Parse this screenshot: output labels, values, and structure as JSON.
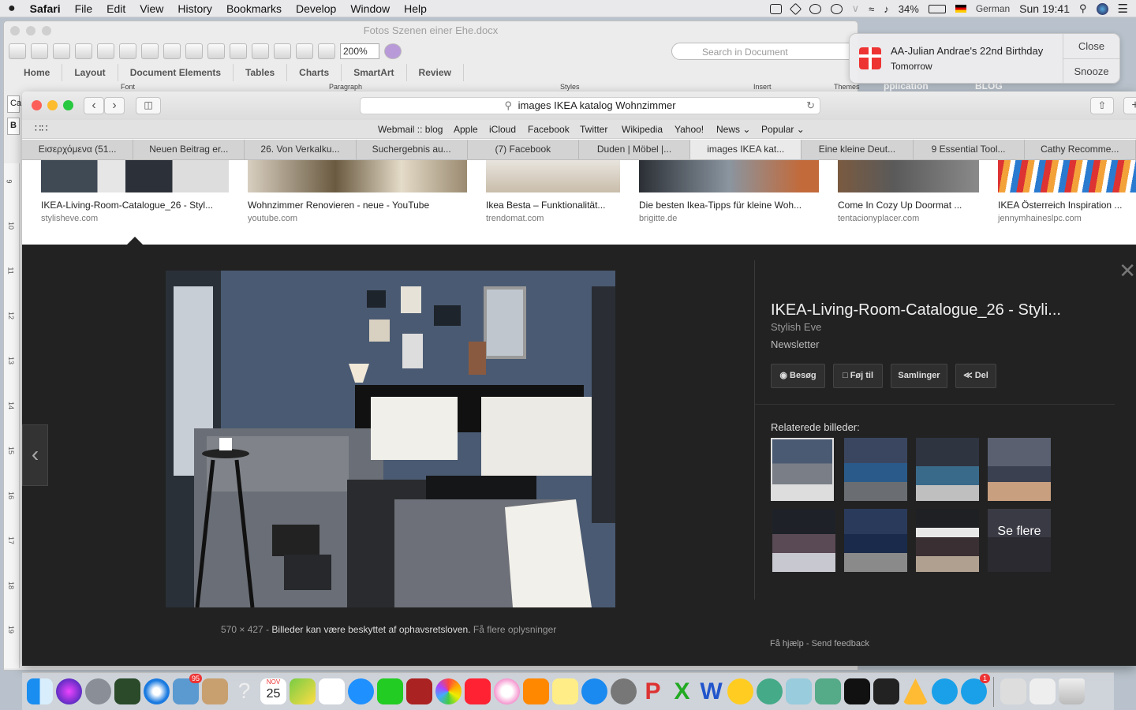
{
  "menubar": {
    "app": "Safari",
    "items": [
      "File",
      "Edit",
      "View",
      "History",
      "Bookmarks",
      "Develop",
      "Window",
      "Help"
    ],
    "battery": "34%",
    "input_language": "German",
    "clock": "Sun 19:41"
  },
  "word": {
    "doc_title": "Fotos Szenen einer Ehe.docx",
    "zoom": "200%",
    "search_placeholder": "Search in Document",
    "ribbon_tabs": [
      "Home",
      "Layout",
      "Document Elements",
      "Tables",
      "Charts",
      "SmartArt",
      "Review"
    ],
    "ribbon_groups": [
      "Font",
      "Paragraph",
      "Styles",
      "Insert",
      "Themes"
    ],
    "font_box": "Ca",
    "bold_box": "B",
    "ruler_numbers": [
      "9",
      "10",
      "11",
      "12",
      "13",
      "14",
      "15",
      "16",
      "17",
      "18",
      "19"
    ]
  },
  "background_text": {
    "application": "pplication",
    "blog": "BLOG"
  },
  "notification": {
    "title": "AA-Julian Andrae's 22nd Birthday",
    "subtitle": "Tomorrow",
    "close": "Close",
    "snooze": "Snooze"
  },
  "safari": {
    "address": "images IKEA katalog Wohnzimmer",
    "favorites": [
      "Webmail :: blog",
      "Apple",
      "iCloud",
      "Facebook",
      "Twitter",
      "Wikipedia",
      "Yahoo!",
      "News",
      "Popular"
    ],
    "tabs": [
      "Εισερχόμενα (51...",
      "Neuen Beitrag er...",
      "26. Von Verkalku...",
      "Suchergebnis au...",
      "(7) Facebook",
      "Duden | Möbel |...",
      "images IKEA kat...",
      "Eine kleine Deut...",
      "9 Essential Tool...",
      "Cathy Recomme..."
    ],
    "active_tab": 6
  },
  "results": [
    {
      "title": "IKEA-Living-Room-Catalogue_26 - Styl...",
      "domain": "stylisheve.com"
    },
    {
      "title": "Wohnzimmer Renovieren - neue - YouTube",
      "domain": "youtube.com"
    },
    {
      "title": "Ikea Besta – Funktionalität...",
      "domain": "trendomat.com"
    },
    {
      "title": "Die besten Ikea-Tipps für kleine Woh...",
      "domain": "brigitte.de"
    },
    {
      "title": "Come In Cozy Up Doormat ...",
      "domain": "tentacionyplacer.com"
    },
    {
      "title": "IKEA Österreich Inspiration ...",
      "domain": "jennymhaineslpc.com"
    }
  ],
  "viewer": {
    "title": "IKEA-Living-Room-Catalogue_26 - Styli...",
    "source": "Stylish Eve",
    "description": "Newsletter",
    "buttons": [
      "Besøg",
      "Føj til",
      "Samlinger",
      "Del"
    ],
    "related_label": "Relaterede billeder:",
    "see_more": "Se flere",
    "dimensions": "570 × 427",
    "separator": "-",
    "copyright": "Billeder kan være beskyttet af ophavsretsloven.",
    "more_info": "Få flere oplysninger",
    "help": "Få hjælp",
    "feedback": "Send feedback",
    "footer_sep": "-"
  },
  "dock": {
    "calendar_month": "NOV",
    "calendar_day": "25",
    "mail_badge": "95",
    "skype_badge": "1"
  }
}
